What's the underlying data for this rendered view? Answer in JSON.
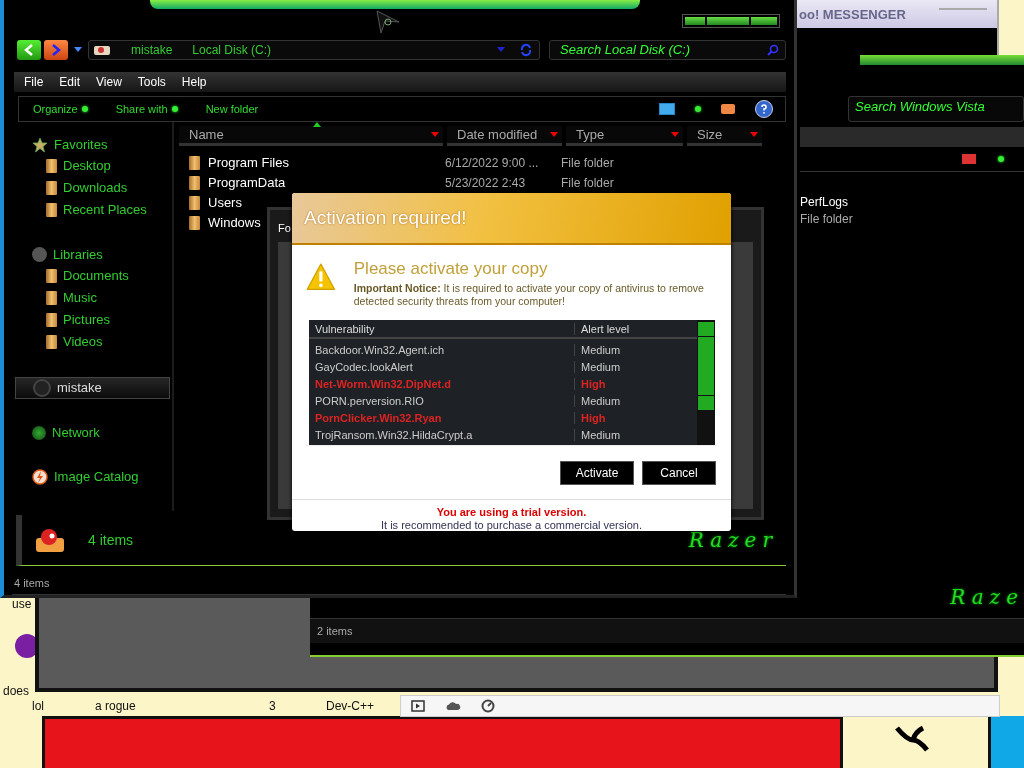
{
  "desktop": {
    "texts": [
      "use",
      "does"
    ],
    "bottom_row": [
      "lol",
      "a rogue",
      "3",
      "Dev-C++"
    ]
  },
  "messenger_window": {
    "title": "oo! MESSENGER"
  },
  "vista_window": {
    "search": {
      "placeholder": "Search Windows Vista"
    },
    "items": [
      {
        "name": "PerfLogs",
        "type": "File folder"
      }
    ],
    "logo": "Raze",
    "status": "2 items"
  },
  "explorer": {
    "address": {
      "crumbs": [
        "mistake",
        "Local Disk (C:)"
      ]
    },
    "search": {
      "placeholder": "Search Local Disk (C:)"
    },
    "menu": [
      "File",
      "Edit",
      "View",
      "Tools",
      "Help"
    ],
    "commands": [
      {
        "label": "Organize",
        "dropdown": true
      },
      {
        "label": "Share with",
        "dropdown": true
      },
      {
        "label": "New folder",
        "dropdown": false
      }
    ],
    "sidebar": [
      {
        "label": "Favorites",
        "selected": false,
        "children": [
          {
            "label": "Desktop",
            "selected": false
          },
          {
            "label": "Downloads",
            "selected": false
          },
          {
            "label": "Recent Places",
            "selected": false
          }
        ]
      },
      {
        "label": "Libraries",
        "selected": false,
        "children": [
          {
            "label": "Documents",
            "selected": false
          },
          {
            "label": "Music",
            "selected": false
          },
          {
            "label": "Pictures",
            "selected": false
          },
          {
            "label": "Videos",
            "selected": false
          }
        ]
      },
      {
        "label": "mistake",
        "selected": true
      },
      {
        "label": "Network",
        "selected": false
      },
      {
        "label": "Image Catalog",
        "selected": false
      }
    ],
    "columns": [
      "Name",
      "Date modified",
      "Type",
      "Size"
    ],
    "rows": [
      {
        "name": "Program Files",
        "date": "6/12/2022 9:00 ...",
        "type": "File folder"
      },
      {
        "name": "ProgramData",
        "date": "5/23/2022 2:43",
        "type": "File folder"
      },
      {
        "name": "Users"
      },
      {
        "name": "Windows"
      }
    ],
    "details": "4 items",
    "logo": "Razer",
    "status": "4 items"
  },
  "background_dialog": {
    "text": "Fo"
  },
  "dialog": {
    "title": "Activation required!",
    "heading": "Please activate your copy",
    "notice": "**Important Notice:** It is required to activate your copy of antivirus to remove detected security threats from your computer!",
    "columns": [
      "Vulnerability",
      "Alert level"
    ],
    "threats": [
      {
        "name": "Backdoor.Win32.Agent.ich",
        "level": "Medium",
        "kind": "medium"
      },
      {
        "name": "GayCodec.lookAlert",
        "level": "Medium",
        "kind": "medium"
      },
      {
        "name": "Net-Worm.Win32.DipNet.d",
        "level": "High",
        "kind": "high"
      },
      {
        "name": "PORN.perversion.RIO",
        "level": "Medium",
        "kind": "medium"
      },
      {
        "name": "PornClicker.Win32.Ryan",
        "level": "High",
        "kind": "high"
      },
      {
        "name": "TrojRansom.Win32.HildaCrypt.a",
        "level": "Medium",
        "kind": "medium"
      }
    ],
    "buttons": [
      "Activate",
      "Cancel"
    ],
    "warning": "You are using a trial version.",
    "note": "It is recommended to purchase a commercial version."
  }
}
